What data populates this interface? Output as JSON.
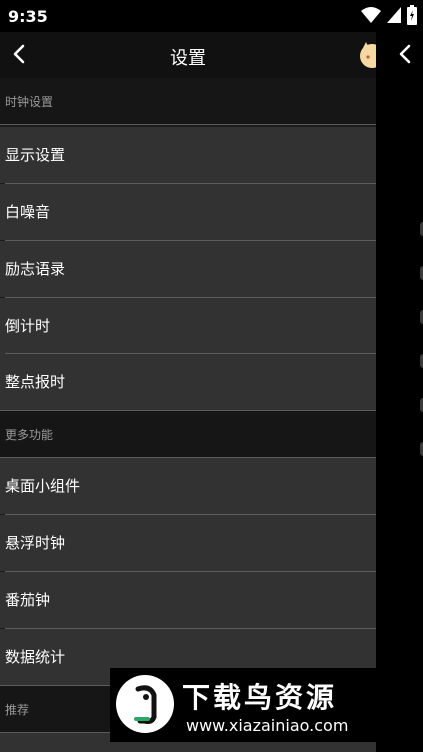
{
  "status": {
    "time": "9:35"
  },
  "header": {
    "title": "设置"
  },
  "sections": [
    {
      "title": "时钟设置",
      "items": [
        "显示设置",
        "白噪音",
        "励志语录",
        "倒计时",
        "整点报时"
      ]
    },
    {
      "title": "更多功能",
      "items": [
        "桌面小组件",
        "悬浮时钟",
        "番茄钟",
        "数据统计"
      ]
    },
    {
      "title": "推荐",
      "items": []
    }
  ],
  "watermark": {
    "title": "下载鸟资源",
    "url": "www.xiazainiao.com"
  },
  "colors": {
    "item_bg": "#333232",
    "header_bg": "#161616",
    "appbar_bg": "#111111",
    "divider": "#5c5c5c"
  }
}
